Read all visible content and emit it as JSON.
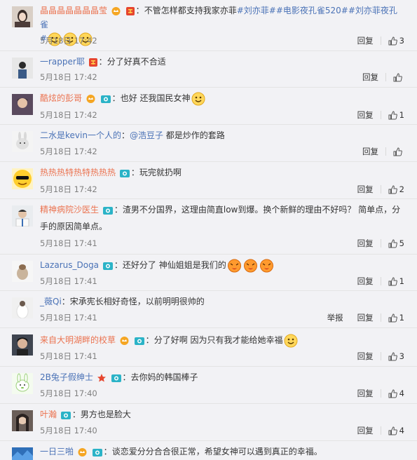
{
  "comments": [
    {
      "user": "晶晶晶晶晶晶晶莹",
      "text": "不管怎样都支持我家亦菲",
      "topics": "#刘亦菲##电影夜孔雀520##刘亦菲夜孔雀",
      "trail": "#",
      "time": "5月18日 17:42",
      "reply": "回复",
      "likes": "3"
    },
    {
      "user": "一rapper耶",
      "text": "分了好真不合适",
      "time": "5月18日 17:42",
      "reply": "回复",
      "likes": ""
    },
    {
      "user": "酷炫的彭哥",
      "text": "也好 还我国民女神",
      "time": "5月18日 17:42",
      "reply": "回复",
      "likes": "1"
    },
    {
      "user": "二水是kevin一个人的",
      "mention": "@浩豆子",
      "text": " 都是炒作的套路",
      "time": "5月18日 17:42",
      "reply": "回复",
      "likes": ""
    },
    {
      "user": "热热热特热特热热热",
      "text": "玩完就扔啊",
      "time": "5月18日 17:42",
      "reply": "回复",
      "likes": "2"
    },
    {
      "user": "精神病院沙医生",
      "text": "渣男不分国界，这理由简直low到爆。换个新鲜的理由不好吗？ 简单点，分手的原因简单点。",
      "time": "5月18日 17:41",
      "reply": "回复",
      "likes": "5"
    },
    {
      "user": "Lazarus_Doga",
      "text": "还好分了 神仙姐姐是我们的",
      "time": "5月18日 17:41",
      "reply": "回复",
      "likes": "1"
    },
    {
      "user": "_薇Qi",
      "text": "宋承宪长相好奇怪，以前明明很帅的",
      "time": "5月18日 17:41",
      "report": "举报",
      "reply": "回复",
      "likes": "1"
    },
    {
      "user": "来自大明湖畔的校草",
      "text": "分了好啊 因为只有我才能给她幸福",
      "time": "5月18日 17:41",
      "reply": "回复",
      "likes": "3"
    },
    {
      "user": "2B兔子假绅士",
      "text": "去你妈的韩国棒子",
      "time": "5月18日 17:40",
      "reply": "回复",
      "likes": "4"
    },
    {
      "user": "叶瀚",
      "text": "男方也是脸大",
      "time": "5月18日 17:40",
      "reply": "回复",
      "likes": "4"
    },
    {
      "user": "一日三啪",
      "text": "谈恋爱分分合合很正常，希望女神可以遇到真正的幸福。",
      "time": "",
      "reply": "",
      "likes": ""
    }
  ],
  "colors": {
    "username_orange": "#eb7350",
    "link_blue": "#4a72b6",
    "meta_gray": "#808080"
  },
  "icons": {
    "vip": "vip-crown-icon",
    "member": "member-badge-icon",
    "camera": "camera-badge-icon",
    "like": "thumbs-up-icon",
    "smile": "smile-emoji",
    "kiss": "kiss-emoji",
    "star": "star-badge-icon"
  }
}
